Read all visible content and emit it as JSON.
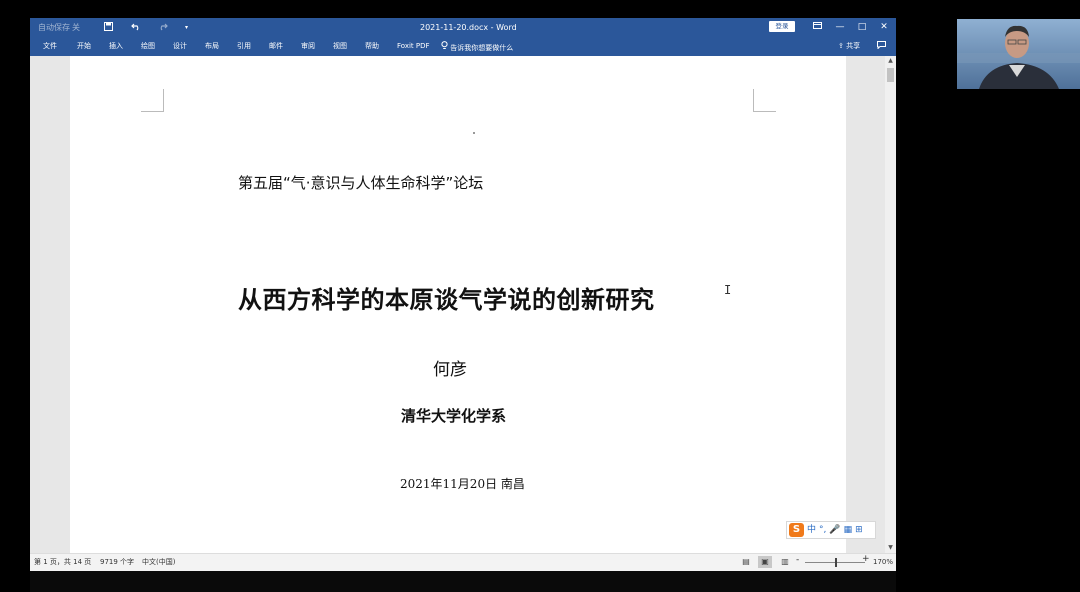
{
  "titlebar": {
    "autosave_label": "自动保存",
    "autosave_state": "关",
    "save_icon": "save-icon",
    "undo_icon": "undo-icon",
    "redo_icon": "redo-icon",
    "more_icon": "more-icon",
    "doc_title": "2021-11-20.docx - Word",
    "login_label": "登录",
    "ribbon_options_icon": "ribbon-options-icon",
    "minimize_glyph": "—",
    "maximize_glyph": "□",
    "close_glyph": "✕"
  },
  "ribbon": {
    "tabs": [
      "文件",
      "开始",
      "插入",
      "绘图",
      "设计",
      "布局",
      "引用",
      "邮件",
      "审阅",
      "视图",
      "帮助",
      "Foxit PDF"
    ],
    "tell_me": "告诉我你想要做什么",
    "share_label": "共享",
    "comment_icon": "comment-icon"
  },
  "document": {
    "forum": "第五届“气·意识与人体生命科学”论坛",
    "title": "从西方科学的本原谈气学说的创新研究",
    "author": "何彦",
    "affiliation": "清华大学化学系",
    "date": "2021年11月20日  南昌",
    "cursor_glyph": "I"
  },
  "ime": {
    "logo": "S",
    "items": [
      "中",
      "°,",
      "🎤",
      "▦",
      "⊞"
    ]
  },
  "statusbar": {
    "page": "第 1 页，共 14 页",
    "words": "9719 个字",
    "language": "中文(中国)",
    "zoom_minus": "-",
    "zoom_plus": "+",
    "zoom_level": "170%"
  },
  "colors": {
    "word_blue": "#2b579a",
    "ime_orange": "#f07a1a"
  }
}
